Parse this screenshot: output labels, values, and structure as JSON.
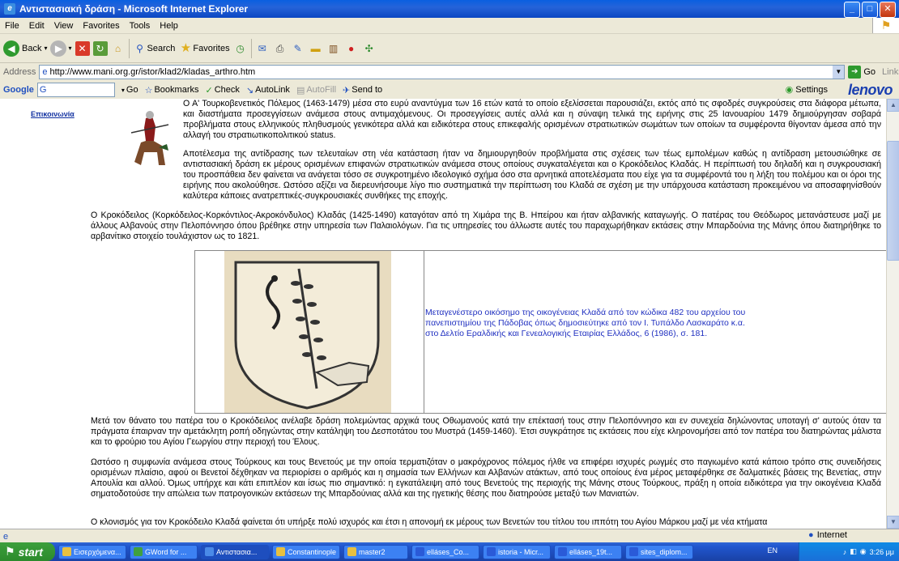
{
  "window": {
    "title": "Αντιστασιακή δράση - Microsoft Internet Explorer"
  },
  "menu": [
    "File",
    "Edit",
    "View",
    "Favorites",
    "Tools",
    "Help"
  ],
  "toolbar": {
    "back": "Back",
    "search": "Search",
    "favorites": "Favorites"
  },
  "address": {
    "label": "Address",
    "url": "http://www.mani.org.gr/istor/klad2/kladas_arthro.htm",
    "go": "Go",
    "links": "Links"
  },
  "google": {
    "label": "Google",
    "box": "G",
    "go": "Go",
    "bookmarks": "Bookmarks",
    "check": "Check",
    "autolink": "AutoLink",
    "autofill": "AutoFill",
    "sendto": "Send to",
    "settings": "Settings",
    "brand": "lenovo"
  },
  "sidebar": {
    "contact": "Επικοινωνία"
  },
  "article": {
    "p1": "Ο Α' Τουρκοβενετικός Πόλεμος (1463-1479) μέσα στο ευρύ αναντύγμα των 16 ετών κατά το οποίο εξελίσσεται παρουσιάζει, εκτός από τις σφοδρές συγκρούσεις στα διάφορα μέτωπα, και διαστήματα προσεγγίσεων ανάμεσα στους αντιμαχόμενους. Οι προσεγγίσεις αυτές αλλά και η σύναψη τελικά της ειρήνης στις 25 Ιανουαρίου 1479 δημιούργησαν σοβαρά προβλήματα στους ελληνικούς πληθυσμούς γενικότερα αλλά και ειδικότερα στους επικεφαλής ορισμένων στρατιωτικών σωμάτων των οποίων τα συμφέροντα θίγονταν άμεσα από την αλλαγή του στρατιωτικοπολιτικού status.",
    "p2": "Αποτέλεσμα της αντίδρασης των τελευταίων στη νέα κατάσταση ήταν να δημιουργηθούν προβλήματα στις σχέσεις των τέως εμπολέμων καθώς η αντίδραση μετουσιώθηκε σε αντιστασιακή δράση εκ μέρους ορισμένων επιφανών στρατιωτικών ανάμεσα στους οποίους συγκαταλέγεται και ο Κροκόδειλος Κλαδάς. Η περίπτωσή του δηλαδή και η συγκρουσιακή του προσπάθεια δεν φαίνεται να ανάγεται τόσο σε συγκροτημένο ιδεολογικό σχήμα όσο στα αρνητικά αποτελέσματα που είχε για τα συμφέροντά του η λήξη του πολέμου και οι όροι της ειρήνης που ακολούθησε. Ωστόσο αξίζει να διερευνήσουμε λίγο πιο συστηματικά την περίπτωση του Κλαδά σε σχέση με την υπάρχουσα κατάσταση προκειμένου να αποσαφηνίσθούν καλύτερα κάποιες ανατρεπτικές-συγκρουσιακές συνθήκες της εποχής.",
    "p3": "Ο Κροκόδειλος (Κορκόδειλος-Κορκόντιλος-Ακροκόνδυλος) Κλαδάς (1425-1490) καταγόταν από τη Χιμάρα της Β. Ηπείρου και ήταν αλβανικής καταγωγής. Ο πατέρας του Θεόδωρος μετανάστευσε μαζί με άλλους Αλβανούς στην Πελοπόννησο όπου βρέθηκε στην υπηρεσία των Παλαιολόγων. Για τις υπηρεσίες του άλλωστε αυτές του παραχωρήθηκαν εκτάσεις στην Μπαρδούνια της Μάνης όπου διατηρήθηκε το αρβανίτικο στοιχείο τουλάχιστον ως το 1821.",
    "caption": "Μεταγενέστερο οικόσημο της οικογένειας Κλαδά από τον κώδικα 482 του αρχείου του πανεπιστημίου της Πάδοβας όπως δημοσιεύτηκε από τον Ι. Τυπάλδο Λασκαράτο κ.α. στο Δελτίο Εραλδικής και Γενεαλογικής Εταιρίας Ελλάδος, 6 (1986), σ. 181.",
    "p4": "Μετά τον θάνατο του πατέρα του ο Κροκόδειλος ανέλαβε δράση πολεμώντας αρχικά τους Οθωμανούς κατά την επέκτασή τους στην Πελοπόννησο και εν συνεχεία δηλώνοντας υποταγή σ' αυτούς όταν τα πράγματα έπαιρναν την αμετάκλητη ροπή οδηγώντας στην κατάληψη του Δεσποτάτου του Μυστρά (1459-1460). Έτσι συγκράτησε τις εκτάσεις που είχε κληρονομήσει από τον πατέρα του διατηρώντας μάλιστα και το φρούριο του Αγίου Γεωργίου στην περιοχή του Έλους.",
    "p5": "Ωστόσο η συμφωνία ανάμεσα στους Τούρκους και τους Βενετούς με την οποία τερματιζόταν ο μακρόχρονος πόλεμος ήλθε να επιφέρει ισχυρές ρωγμές στο παγιωμένο κατά κάποιο τρόπο στις συνειδήσεις ορισμένων πλαίσιο, αφού οι Βενετοί δέχθηκαν να περιορίσει ο αριθμός και η σημασία των Ελλήνων και Αλβανών ατάκτων, από τους οποίους ένα μέρος μεταφέρθηκε σε δαλματικές βάσεις της Βενετίας, στην Απουλία και αλλού. Όμως υπήρχε και κάτι επιπλέον και ίσως πιο σημαντικό: η εγκατάλειψη από τους Βενετούς της περιοχής της Μάνης στους Τούρκους, πράξη η οποία ειδικότερα για την οικογένεια Κλαδά σηματοδοτούσε την απώλεια των πατρογονικών εκτάσεων της Μπαρδούνιας αλλά και της ηγετικής θέσης που διατηρούσε μεταξύ των Μανιατών.",
    "p6": "Ο κλονισμός για τον Κροκόδειλο Κλαδά φαίνεται ότι υπήρξε πολύ ισχυρός και έτσι η απονομή εκ μέρους των Βενετών του τίτλου του ιππότη του Αγίου Μάρκου μαζί με νέα κτήματα"
  },
  "status": {
    "zone": "Internet"
  },
  "taskbar": {
    "start": "start",
    "items": [
      "Εισερχόμενα...",
      "GWord for ...",
      "Αντιστασια...",
      "Constantinople",
      "master2",
      "elláses_Co...",
      "istoria - Micr...",
      "elláses_19t...",
      "sites_diplom..."
    ],
    "lang": "EN",
    "time": "3:26 μμ"
  }
}
